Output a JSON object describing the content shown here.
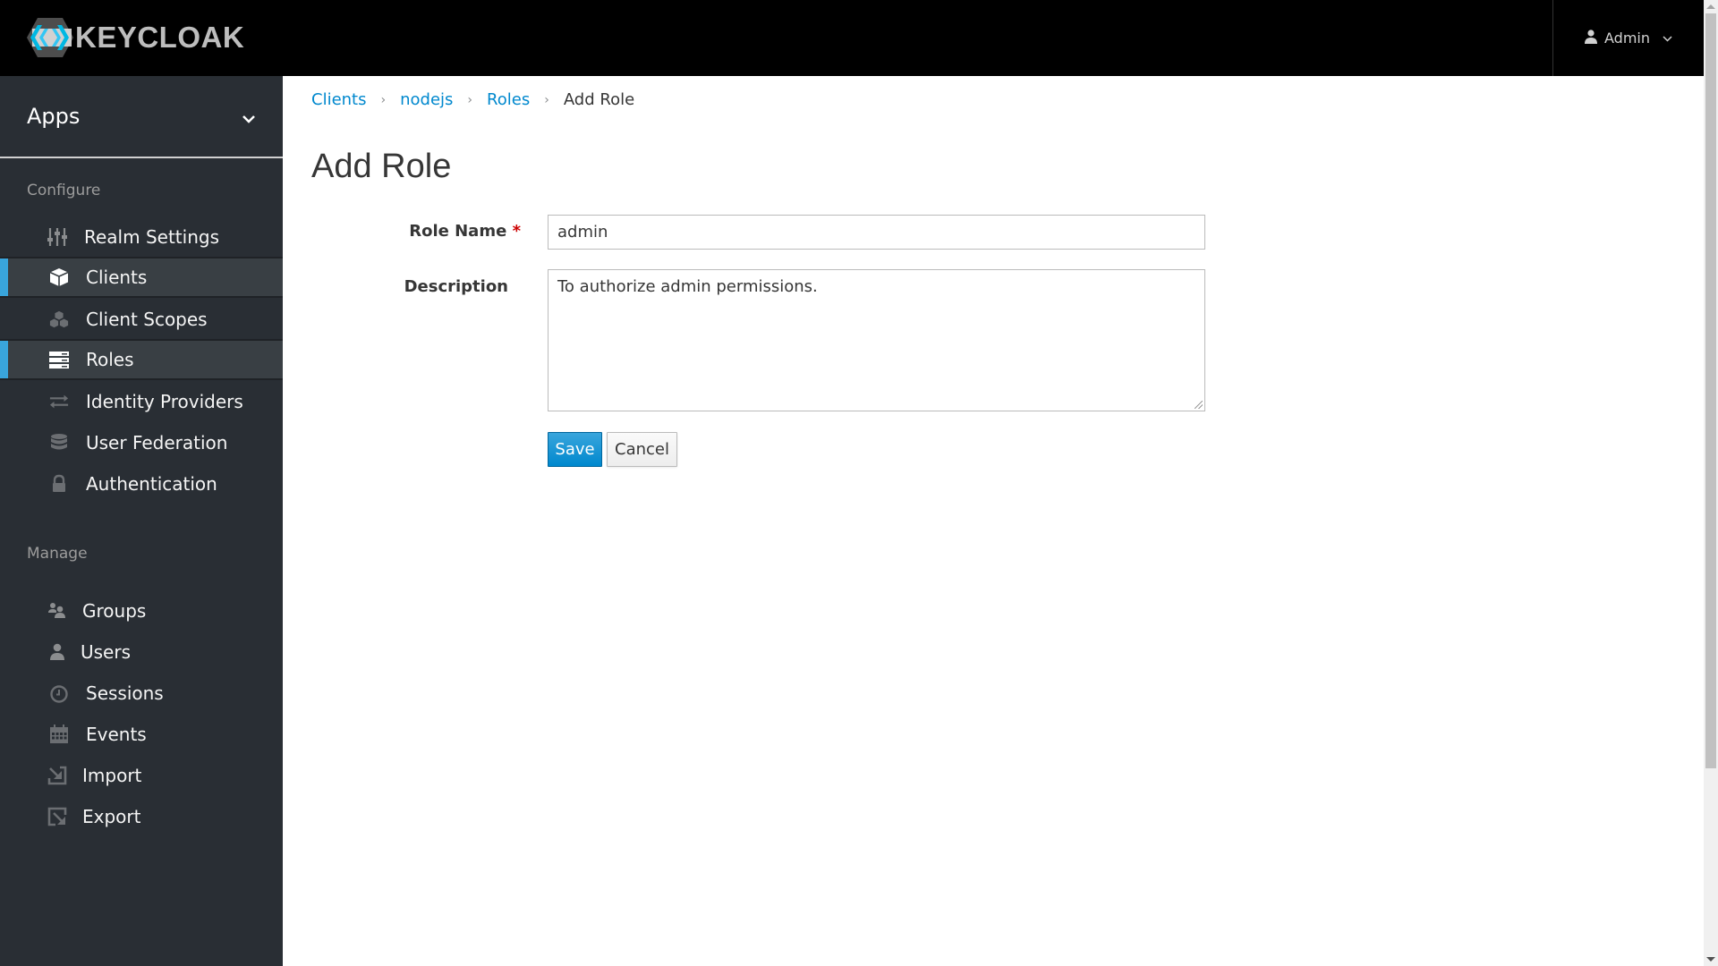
{
  "brand": {
    "name": "KEYCLOAK",
    "accent": "#39a5dc"
  },
  "topbar": {
    "user_label": "Admin",
    "user_icon": "user-icon",
    "dropdown_icon": "chevron-down-icon"
  },
  "sidebar": {
    "realm_selector": "Apps",
    "configure_label": "Configure",
    "configure_items": [
      {
        "label": "Realm Settings",
        "icon": "sliders-icon",
        "active": false
      },
      {
        "label": "Clients",
        "icon": "cube-icon",
        "active": true
      },
      {
        "label": "Client Scopes",
        "icon": "cubes-icon",
        "active": false
      },
      {
        "label": "Roles",
        "icon": "server-icon",
        "active": true
      },
      {
        "label": "Identity Providers",
        "icon": "exchange-icon",
        "active": false
      },
      {
        "label": "User Federation",
        "icon": "database-icon",
        "active": false
      },
      {
        "label": "Authentication",
        "icon": "lock-icon",
        "active": false
      }
    ],
    "manage_label": "Manage",
    "manage_items": [
      {
        "label": "Groups",
        "icon": "users-icon"
      },
      {
        "label": "Users",
        "icon": "user-icon"
      },
      {
        "label": "Sessions",
        "icon": "clock-icon"
      },
      {
        "label": "Events",
        "icon": "calendar-icon"
      },
      {
        "label": "Import",
        "icon": "import-icon"
      },
      {
        "label": "Export",
        "icon": "export-icon"
      }
    ]
  },
  "breadcrumb": [
    {
      "label": "Clients",
      "link": true
    },
    {
      "label": "nodejs",
      "link": true
    },
    {
      "label": "Roles",
      "link": true
    },
    {
      "label": "Add Role",
      "link": false
    }
  ],
  "page": {
    "title": "Add Role",
    "form": {
      "role_name_label": "Role Name",
      "required_marker": "*",
      "role_name_value": "admin",
      "description_label": "Description",
      "description_value": "To authorize admin permissions.",
      "save_label": "Save",
      "cancel_label": "Cancel"
    }
  }
}
